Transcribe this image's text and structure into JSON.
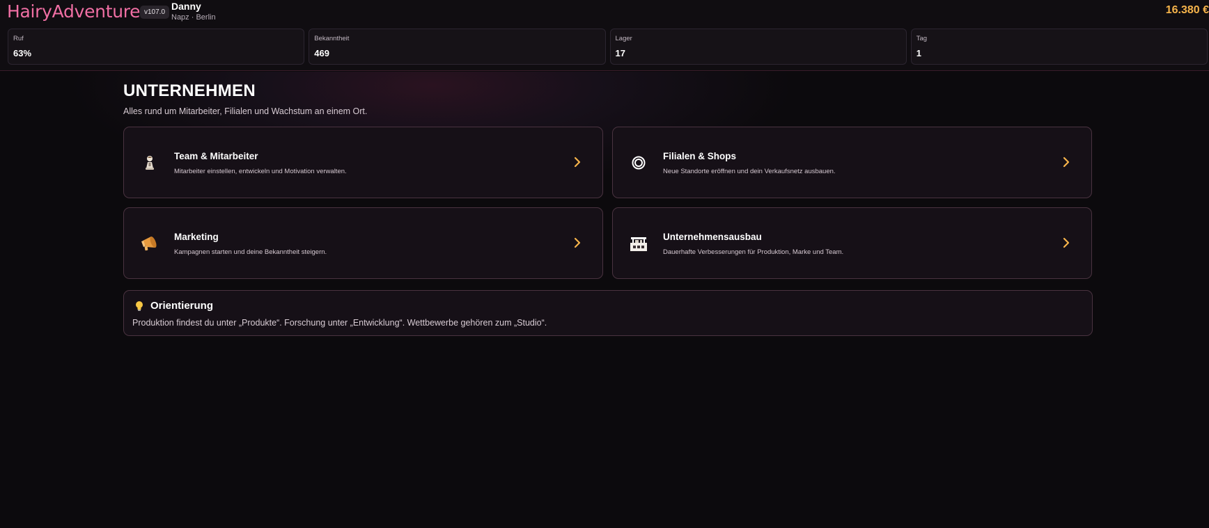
{
  "header": {
    "logo": "HairyAdventure",
    "version": "v107.0",
    "player_name": "Danny",
    "player_sub": "Napz · Berlin",
    "money": "16.380 €"
  },
  "stats": [
    {
      "label": "Ruf",
      "value": "63%"
    },
    {
      "label": "Bekanntheit",
      "value": "469"
    },
    {
      "label": "Lager",
      "value": "17"
    },
    {
      "label": "Tag",
      "value": "1"
    }
  ],
  "page": {
    "title": "UNTERNEHMEN",
    "subtitle": "Alles rund um Mitarbeiter, Filialen und Wachstum an einem Ort."
  },
  "cards": [
    {
      "title": "Team & Mitarbeiter",
      "description": "Mitarbeiter einstellen, entwickeln und Motivation verwalten.",
      "icon": "worker-icon"
    },
    {
      "title": "Filialen & Shops",
      "description": "Neue Standorte eröffnen und dein Verkaufsnetz ausbauen.",
      "icon": "ring-icon"
    },
    {
      "title": "Marketing",
      "description": "Kampagnen starten und deine Bekanntheit steigern.",
      "icon": "megaphone-icon"
    },
    {
      "title": "Unternehmensausbau",
      "description": "Dauerhafte Verbesserungen für Produktion, Marke und Team.",
      "icon": "factory-icon"
    }
  ],
  "info": {
    "title": "Orientierung",
    "text": "Produktion findest du unter „Produkte“. Forschung unter „Entwicklung“. Wettbewerbe gehören zum „Studio“.",
    "icon": "lightbulb-icon"
  },
  "colors": {
    "accent": "#f6b44b",
    "logo": "#f06fa4",
    "card_border": "#4a3340",
    "background": "#0c0a0d"
  }
}
